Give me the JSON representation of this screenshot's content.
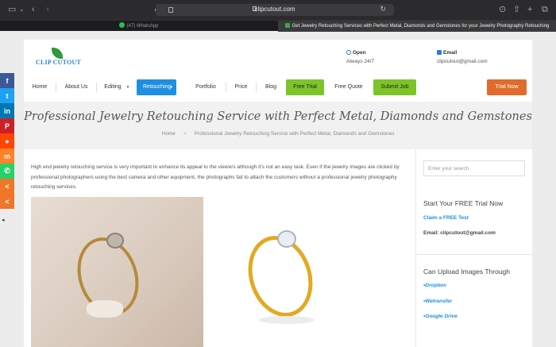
{
  "browser": {
    "url": "clipcutout.com"
  },
  "tabs": [
    {
      "label": "(47) WhatsApp"
    },
    {
      "label": "Get Jewelry Retouching Services with Perfect Metal, Diamonds and Gemstones for your Jewelry Photography Retouching"
    }
  ],
  "header": {
    "logo_text": "CLIP CUTOUT",
    "open": {
      "title": "Open",
      "value": "Always 24/7"
    },
    "email": {
      "title": "Email",
      "value": "clipcutout@gmail.com"
    }
  },
  "nav": {
    "items": [
      "Home",
      "About Us",
      "Editing",
      "Retouching",
      "Portfolio",
      "Price",
      "Blog",
      "Free Trial",
      "Free Quote",
      "Submit Job",
      "Trial Now"
    ]
  },
  "banner": {
    "title": "Professional Jewelry Retouching Service with Perfect Metal, Diamonds and Gemstones",
    "breadcrumb_home": "Home",
    "breadcrumb_current": "Professional Jewelry Retouching Service with Perfect Metal, Diamonds and Gemstones"
  },
  "content": {
    "intro": "High end jewelry retouching service is very important to enhance its appeal to the viewers although it's not an easy task. Even if the jewelry images are clicked by professional photographers using the best camera and other equipment, the photographs fail to attach the customers without a professional jewelry photography retouching services."
  },
  "sidebar": {
    "search_placeholder": "Enter your search",
    "trial_heading": "Start Your FREE Trial Now",
    "claim_link": "Claim a FREE Test",
    "email_line": "Email: clipcutout@gmail.com",
    "upload_heading": "Can Upload Images Through",
    "upload_options": [
      "•Dropbox",
      "•Wetransfer",
      "•Google Drive"
    ]
  },
  "share_icons": [
    "facebook-icon",
    "twitter-icon",
    "linkedin-icon",
    "pinterest-icon",
    "reddit-icon",
    "mix-icon",
    "whatsapp-icon",
    "share-icon",
    "share-more-icon"
  ],
  "colors": {
    "accent_blue": "#1e8fe0",
    "accent_green": "#7cc428",
    "accent_orange": "#e06b2a"
  }
}
